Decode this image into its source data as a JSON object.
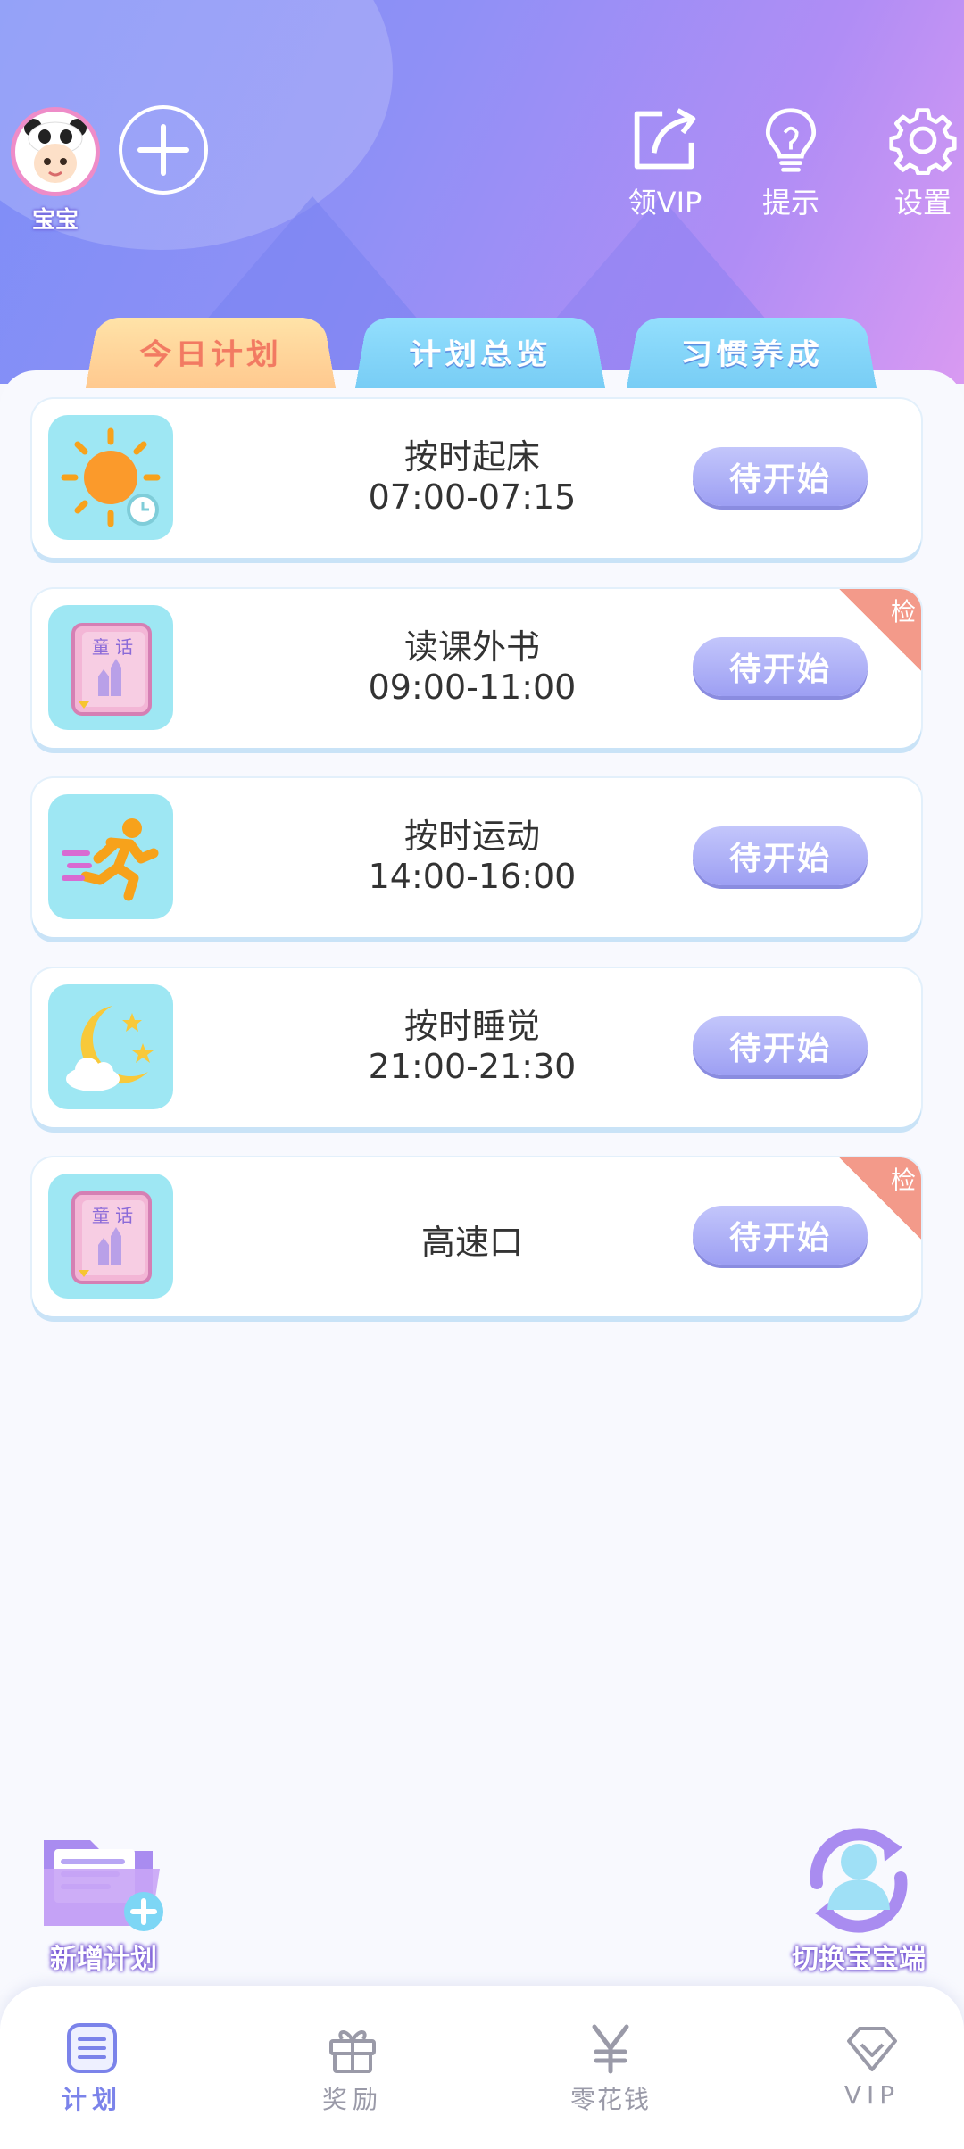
{
  "header": {
    "avatar_name": "宝宝",
    "actions": [
      {
        "label": "领VIP",
        "icon": "share-icon"
      },
      {
        "label": "提示",
        "icon": "lightbulb-icon"
      },
      {
        "label": "设置",
        "icon": "gear-icon"
      }
    ]
  },
  "tabs": [
    {
      "label": "今日计划",
      "active": true
    },
    {
      "label": "计划总览",
      "active": false
    },
    {
      "label": "习惯养成",
      "active": false
    }
  ],
  "tasks": [
    {
      "title": "按时起床",
      "time": "07:00-07:15",
      "status": "待开始",
      "icon": "sun-clock-icon",
      "tag": ""
    },
    {
      "title": "读课外书",
      "time": "09:00-11:00",
      "status": "待开始",
      "icon": "storybook-icon",
      "tag": "检"
    },
    {
      "title": "按时运动",
      "time": "14:00-16:00",
      "status": "待开始",
      "icon": "running-person-icon",
      "tag": ""
    },
    {
      "title": "按时睡觉",
      "time": "21:00-21:30",
      "status": "待开始",
      "icon": "moon-stars-icon",
      "tag": ""
    },
    {
      "title": "高速口",
      "time": "",
      "status": "待开始",
      "icon": "storybook-icon",
      "tag": "检"
    }
  ],
  "fabs": {
    "add_plan": "新增计划",
    "switch_child": "切换宝宝端"
  },
  "bottom_nav": [
    {
      "label": "计划",
      "icon": "plan-icon",
      "active": true
    },
    {
      "label": "奖励",
      "icon": "gift-icon",
      "active": false
    },
    {
      "label": "零花钱",
      "icon": "yen-icon",
      "active": false
    },
    {
      "label": "VIP",
      "icon": "diamond-icon",
      "active": false
    }
  ],
  "colors": {
    "active_tab_text": "#f27a62",
    "status_button": "#a4a6f5",
    "nav_active": "#7b83ea",
    "nav_inactive": "#9a9aa8"
  }
}
